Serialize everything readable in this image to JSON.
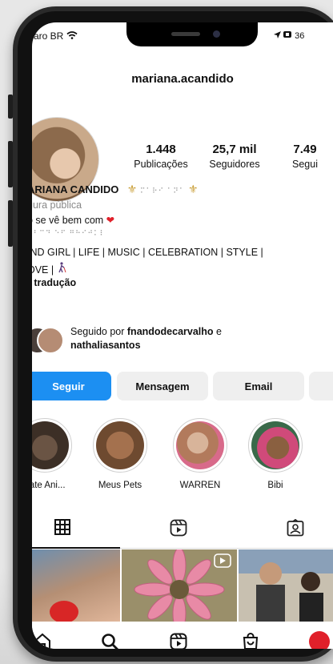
{
  "status": {
    "carrier": "aro BR",
    "right": "36"
  },
  "profile": {
    "username": "mariana.acandido",
    "stats": [
      {
        "num": "1.448",
        "label": "Publicações"
      },
      {
        "num": "25,7 mil",
        "label": "Seguidores"
      },
      {
        "num": "7.49",
        "label": "Segui"
      }
    ],
    "name": "ARIANA CANDIDO",
    "category": "gura pública",
    "bio_line1": "o se vê bem com",
    "bio_braille": "⠁⠃⠉⠙ ⠑⠋ ⠛⠓⠊⠚⠅⠇",
    "name_braille": "⠍⠁⠗⠊ ⠁⠝⠁",
    "bio_line2": "IND GIRL | LIFE | MUSIC | CELEBRATION | STYLE |",
    "bio_line3": "OVE |",
    "translation": "r tradução",
    "followed_prefix": "Seguido por ",
    "followed_user1": "fnandodecarvalho",
    "followed_and": " e",
    "followed_user2": "nathaliasantos"
  },
  "buttons": {
    "follow": "Seguir",
    "message": "Mensagem",
    "email": "Email"
  },
  "highlights": [
    {
      "label": "gate Ani..."
    },
    {
      "label": "Meus Pets"
    },
    {
      "label": "WARREN"
    },
    {
      "label": "Bibi"
    }
  ],
  "icons": {
    "grid": "grid-icon",
    "reels": "reels-icon",
    "tagged": "tagged-icon",
    "home": "home-icon",
    "search": "search-icon",
    "reels_nav": "reels-nav-icon",
    "shop": "shop-icon"
  },
  "colors": {
    "accent": "#1c8ff2",
    "heart": "#e0202a",
    "fleur": "#caa03a"
  }
}
